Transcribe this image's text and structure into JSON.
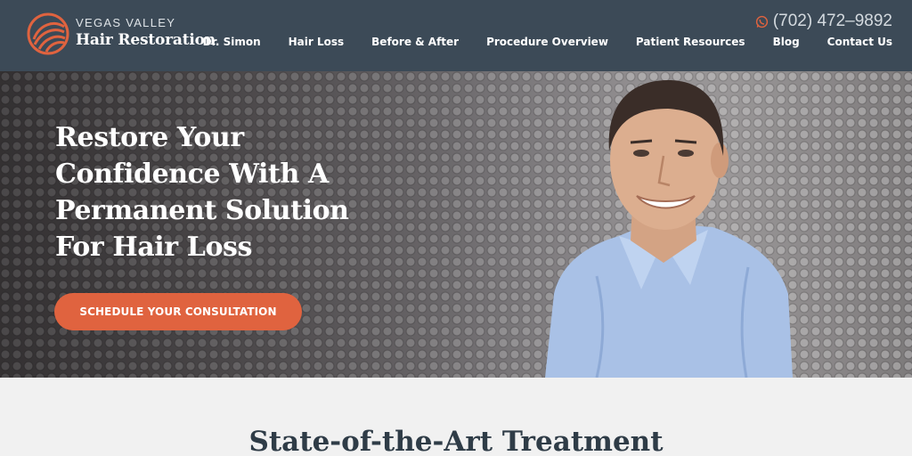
{
  "header": {
    "logo_line1": "VEGAS VALLEY",
    "logo_line2": "Hair Restoration",
    "phone": "(702) 472–9892",
    "nav": [
      "Dr. Simon",
      "Hair Loss",
      "Before & After",
      "Procedure Overview",
      "Patient Resources",
      "Blog",
      "Contact Us"
    ]
  },
  "hero": {
    "title": "Restore Your Confidence With A Permanent Solution For Hair Loss",
    "cta": "SCHEDULE YOUR CONSULTATION"
  },
  "section": {
    "title": "State-of-the-Art Treatment"
  },
  "colors": {
    "header_bg": "#3c4a57",
    "accent": "#e0633f"
  },
  "icons": {
    "logo": "swirl-logo-icon",
    "phone": "whatsapp-phone-icon"
  }
}
